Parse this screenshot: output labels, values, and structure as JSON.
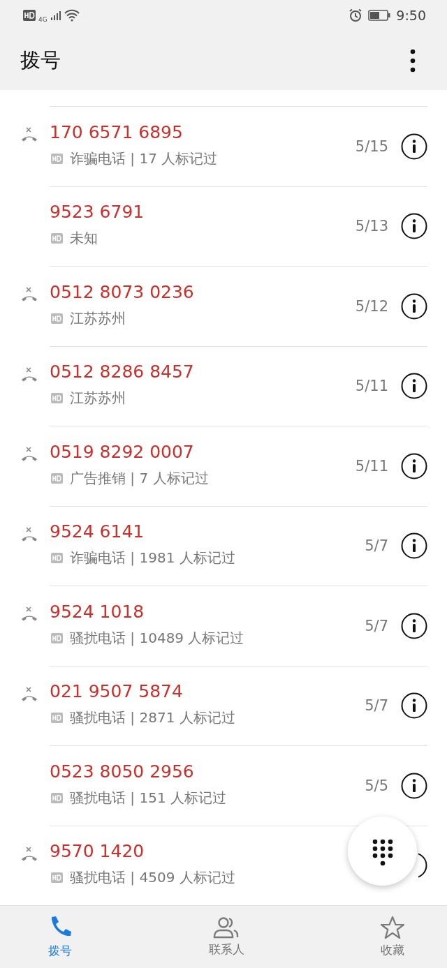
{
  "status_bar": {
    "network": "4G",
    "time": "9:50"
  },
  "header": {
    "title": "拨号"
  },
  "calls": [
    {
      "number": "170 6571 6895",
      "label": "诈骗电话 | 17 人标记过",
      "date": "5/15",
      "missed": true
    },
    {
      "number": "9523 6791",
      "label": "未知",
      "date": "5/13",
      "missed": false
    },
    {
      "number": "0512 8073 0236",
      "label": "江苏苏州",
      "date": "5/12",
      "missed": true
    },
    {
      "number": "0512 8286 8457",
      "label": "江苏苏州",
      "date": "5/11",
      "missed": true
    },
    {
      "number": "0519 8292 0007",
      "label": "广告推销 | 7 人标记过",
      "date": "5/11",
      "missed": true
    },
    {
      "number": "9524 6141",
      "label": "诈骗电话 | 1981 人标记过",
      "date": "5/7",
      "missed": true
    },
    {
      "number": "9524 1018",
      "label": "骚扰电话 | 10489 人标记过",
      "date": "5/7",
      "missed": true
    },
    {
      "number": "021 9507 5874",
      "label": "骚扰电话 | 2871 人标记过",
      "date": "5/7",
      "missed": true
    },
    {
      "number": "0523 8050 2956",
      "label": "骚扰电话 | 151 人标记过",
      "date": "5/5",
      "missed": false
    },
    {
      "number": "9570 1420",
      "label": "骚扰电话 | 4509 人标记过",
      "missed": true,
      "info_covered": true
    }
  ],
  "nav": [
    {
      "label": "拨号",
      "selected": true
    },
    {
      "label": "联系人",
      "selected": false
    },
    {
      "label": "收藏",
      "selected": false
    }
  ]
}
